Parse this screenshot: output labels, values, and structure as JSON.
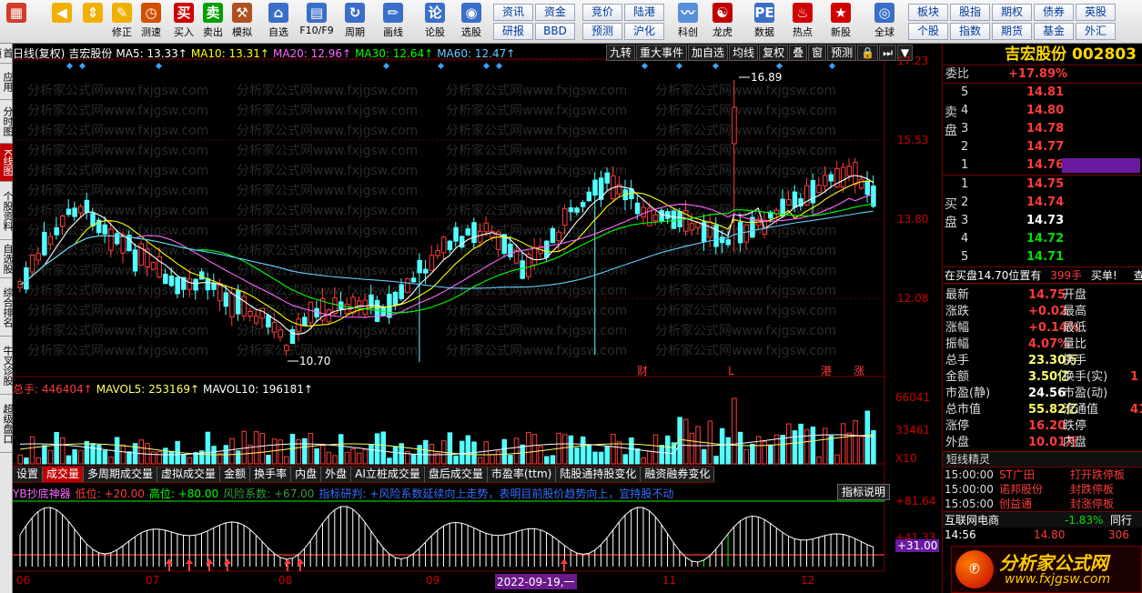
{
  "toolbar": {
    "buttons": [
      {
        "name": "windows-button",
        "label": "",
        "icon": "windows-grid-icon",
        "color": "#d33c2a"
      },
      {
        "name": "back-button",
        "label": "",
        "icon": "back-arrow-icon",
        "color": "#f0b000"
      },
      {
        "name": "up-down-button",
        "label": "",
        "icon": "up-down-arrows-icon",
        "color": "#f0b000"
      },
      {
        "name": "correct-button",
        "label": "修正",
        "icon": "correct-icon",
        "color": "#f0b000"
      },
      {
        "name": "speed-test-button",
        "label": "测速",
        "icon": "clock-icon",
        "color": "#d05000"
      },
      {
        "name": "buy-button",
        "label": "买入",
        "icon": "buy-icon",
        "glyph": "买",
        "color": "#d00000"
      },
      {
        "name": "sell-button",
        "label": "卖出",
        "icon": "sell-icon",
        "glyph": "卖",
        "color": "#00a000"
      },
      {
        "name": "simulate-button",
        "label": "模拟",
        "icon": "hammer-icon",
        "color": "#b05020"
      },
      {
        "name": "watchlist-button",
        "label": "自选",
        "icon": "house-icon",
        "color": "#3a6fc9"
      },
      {
        "name": "f10-button",
        "label": "F10/F9",
        "icon": "doc-icon",
        "color": "#3a6fc9"
      },
      {
        "name": "period-button",
        "label": "周期",
        "icon": "clock-cycle-icon",
        "color": "#3a6fc9"
      },
      {
        "name": "draw-button",
        "label": "画线",
        "icon": "pencil-icon",
        "color": "#3a6fc9"
      },
      {
        "name": "formula-button",
        "label": "论股",
        "icon": "formula-icon",
        "glyph": "论",
        "color": "#3a6fc9"
      },
      {
        "name": "pick-stock-button",
        "label": "选股",
        "icon": "gauge-icon",
        "color": "#3a6fc9"
      }
    ],
    "grid_left": [
      "资讯",
      "资金",
      "研报",
      "BBD"
    ],
    "grid_mid": [
      "竞价",
      "陆港",
      "预测",
      "沪化"
    ],
    "buttons2": [
      {
        "name": "tech-button",
        "label": "科创",
        "icon": "tech-icon",
        "color": "#5a8fd9"
      },
      {
        "name": "dragon-tiger-button",
        "label": "龙虎",
        "icon": "dragon-icon",
        "color": "#c00000"
      },
      {
        "name": "data-button",
        "label": "数据",
        "icon": "pe-icon",
        "glyph": "PE",
        "color": "#3a6fc9"
      },
      {
        "name": "hot-button",
        "label": "热点",
        "icon": "fire-icon",
        "color": "#d00000"
      },
      {
        "name": "new-stock-button",
        "label": "新股",
        "icon": "new-stock-icon",
        "color": "#d00000"
      },
      {
        "name": "global-button",
        "label": "全球",
        "icon": "globe-icon",
        "color": "#3a6fc9"
      }
    ],
    "grid_right": [
      "板块",
      "股指",
      "期权",
      "债券",
      "英股",
      "个股",
      "指数",
      "期货",
      "基金",
      "外汇"
    ]
  },
  "left_tabs": [
    {
      "label": "首页",
      "active": false
    },
    {
      "label": "应用",
      "active": false
    },
    {
      "label": "分时图",
      "active": false
    },
    {
      "label": "K线图",
      "active": true
    },
    {
      "label": "个股资料",
      "active": false
    },
    {
      "label": "自选股",
      "active": false
    },
    {
      "label": "综合排名",
      "active": false
    },
    {
      "label": "牛叉诊股",
      "active": false
    },
    {
      "label": "超级盘口",
      "active": false
    }
  ],
  "main": {
    "head": [
      {
        "text": "日线(复权)",
        "color": "#ffffff"
      },
      {
        "text": "吉宏股份",
        "color": "#ffffff"
      },
      {
        "text": "MA5: 13.33↑",
        "color": "#ffffff"
      },
      {
        "text": "MA10: 13.31↑",
        "color": "#ffff00"
      },
      {
        "text": "MA20: 12.96↑",
        "color": "#ff66ff"
      },
      {
        "text": "MA30: 12.64↑",
        "color": "#00ff00"
      },
      {
        "text": "MA60: 12.47↑",
        "color": "#66ccff"
      }
    ],
    "tools": [
      "九转",
      "重大事件",
      "加自选",
      "均线",
      "复权",
      "叠",
      "窗",
      "预测",
      "🔒",
      "⏭",
      "▼"
    ],
    "price_ticks": [
      "17.23",
      "15.53",
      "13.80",
      "12.08"
    ],
    "high_label": "16.89",
    "low_label": "10.70",
    "event_marks": [
      "财",
      "L",
      "港",
      "涨"
    ],
    "watermark": "分析家公式网www.fxjgsw.com"
  },
  "volume": {
    "head": [
      {
        "text": "总手: 446404↑",
        "color": "#ff3b3b"
      },
      {
        "text": "MAVOL5: 253169↑",
        "color": "#ffff66"
      },
      {
        "text": "MAVOL10: 196181↑",
        "color": "#ffffff"
      }
    ],
    "ticks": [
      "66041",
      "33461",
      "X10"
    ]
  },
  "indicator_tabs": [
    {
      "label": "设置",
      "active": false
    },
    {
      "label": "成交量",
      "active": true
    },
    {
      "label": "多周期成交量",
      "active": false
    },
    {
      "label": "虚拟成交量",
      "active": false
    },
    {
      "label": "金额",
      "active": false
    },
    {
      "label": "换手率",
      "active": false
    },
    {
      "label": "内盘",
      "active": false
    },
    {
      "label": "外盘",
      "active": false
    },
    {
      "label": "AI立桩成交量",
      "active": false
    },
    {
      "label": "盘后成交量",
      "active": false
    },
    {
      "label": "市盈率(ttm)",
      "active": false
    },
    {
      "label": "陆股通持股变化",
      "active": false
    },
    {
      "label": "融资融券变化",
      "active": false
    }
  ],
  "indicator": {
    "head": [
      {
        "text": "YB抄底神器",
        "color": "#ff66ff"
      },
      {
        "text": "低位: +20.00",
        "color": "#ff3b3b"
      },
      {
        "text": "高位: +80.00",
        "color": "#00ff00"
      },
      {
        "text": "风险系数: +67.00",
        "color": "#3a9a3a"
      },
      {
        "text": "指标研判: +风险系数延续向上走势，表明目前股价趋势向上，宜持股不动",
        "color": "#3a6fff"
      }
    ],
    "help": "指标说明",
    "ticks": [
      "+81.64",
      "+41.33",
      "+31.00"
    ]
  },
  "date_axis": [
    {
      "text": "06",
      "sel": false
    },
    {
      "text": "07",
      "sel": false
    },
    {
      "text": "08",
      "sel": false
    },
    {
      "text": "09",
      "sel": false
    },
    {
      "text": "2022-09-19,一",
      "sel": true
    },
    {
      "text": "11",
      "sel": false
    },
    {
      "text": "12",
      "sel": false
    }
  ],
  "quote": {
    "title": "吉宏股份 002803",
    "ratio_label": "委比",
    "ratio_value": "+17.89%",
    "sell_side": "卖盘",
    "buy_side": "买盘",
    "sells": [
      {
        "level": "5",
        "price": "14.81",
        "color": "#ff3b3b",
        "bar": 0
      },
      {
        "level": "4",
        "price": "14.80",
        "color": "#ff3b3b",
        "bar": 0
      },
      {
        "level": "3",
        "price": "14.78",
        "color": "#ff3b3b",
        "bar": 0
      },
      {
        "level": "2",
        "price": "14.77",
        "color": "#ff3b3b",
        "bar": 0
      },
      {
        "level": "1",
        "price": "14.76",
        "color": "#ff3b3b",
        "bar": 1
      }
    ],
    "buys": [
      {
        "level": "1",
        "price": "14.75",
        "color": "#ff3b3b",
        "bar": 0
      },
      {
        "level": "2",
        "price": "14.74",
        "color": "#ff3b3b",
        "bar": 0
      },
      {
        "level": "3",
        "price": "14.73",
        "color": "#ffffff",
        "bar": 0
      },
      {
        "level": "4",
        "price": "14.72",
        "color": "#00e000",
        "bar": 0
      },
      {
        "level": "5",
        "price": "14.71",
        "color": "#00e000",
        "bar": 0
      }
    ],
    "notice_text": "在买盘14.70位置有",
    "notice_qty": "399手",
    "notice_action": "买单!",
    "notice_more": "查",
    "stats": [
      {
        "k1": "最新",
        "v1": "14.75",
        "c1": "#ff3b3b",
        "k2": "开盘",
        "v2": ""
      },
      {
        "k1": "涨跌",
        "v1": "+0.02",
        "c1": "#ff3b3b",
        "k2": "最高",
        "v2": ""
      },
      {
        "k1": "涨幅",
        "v1": "+0.14%",
        "c1": "#ff3b3b",
        "k2": "最低",
        "v2": ""
      },
      {
        "k1": "振幅",
        "v1": "4.07%",
        "c1": "#ff3b3b",
        "k2": "量比",
        "v2": ""
      },
      {
        "k1": "总手",
        "v1": "23.30万",
        "c1": "#ffff66",
        "k2": "换手",
        "v2": ""
      },
      {
        "k1": "金额",
        "v1": "3.50亿",
        "c1": "#ffff66",
        "k2": "换手(实)",
        "v2": "1"
      },
      {
        "k1": "市盈(静)",
        "v1": "24.56",
        "c1": "#ffffff",
        "k2": "市盈(动)",
        "v2": ""
      },
      {
        "k1": "总市值",
        "v1": "55.82亿",
        "c1": "#ffff66",
        "k2": "流通值",
        "v2": "41"
      },
      {
        "k1": "涨停",
        "v1": "16.20",
        "c1": "#ff3b3b",
        "k2": "跌停",
        "v2": ""
      },
      {
        "k1": "外盘",
        "v1": "10.01万",
        "c1": "#ff3b3b",
        "k2": "内盘",
        "v2": ""
      }
    ],
    "news_title": "短线精灵",
    "news": [
      {
        "time": "15:00:00",
        "stock": "ST广田",
        "event": "打开跌停板"
      },
      {
        "time": "15:00:00",
        "stock": "诺邦股份",
        "event": "封跌停板"
      },
      {
        "time": "15:05:00",
        "stock": "创益通",
        "event": "封涨停板"
      }
    ],
    "sector_name": "互联网电商",
    "sector_change": "-1.83%",
    "sector_more": "同行",
    "tick_time": "14:56",
    "tick_price": "14.80",
    "tick_vol": "306"
  },
  "logo": {
    "name": "分析家公式网",
    "url": "www.fxjgsw.com"
  },
  "colors": {
    "up": "#ff3b3b",
    "down": "#54ffff",
    "ma5": "#ffffff",
    "ma10": "#ffff00",
    "ma20": "#ff66ff",
    "ma30": "#00ff00",
    "ma60": "#66ccff"
  }
}
